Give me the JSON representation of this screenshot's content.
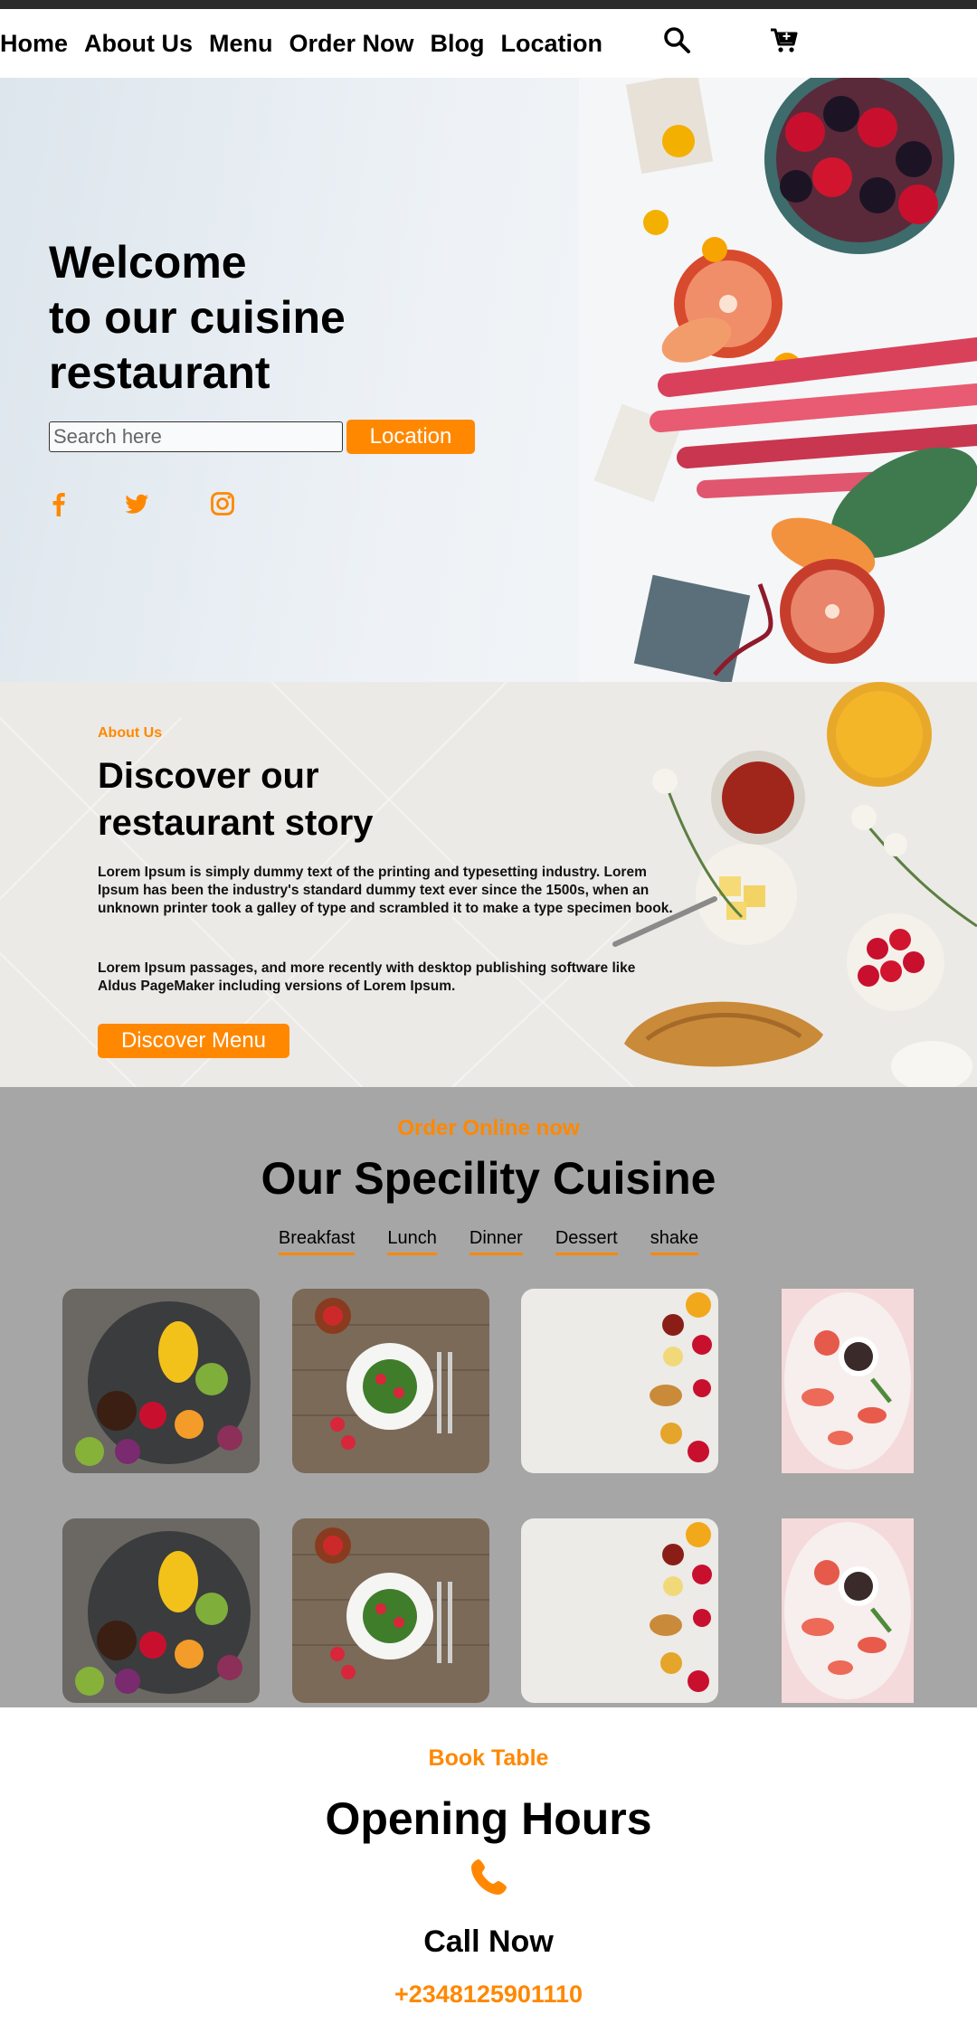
{
  "nav": {
    "links": [
      "Home",
      "About Us",
      "Menu",
      "Order Now",
      "Blog",
      "Location"
    ],
    "icons": [
      "search-icon",
      "cart-icon"
    ]
  },
  "hero": {
    "title_lines": [
      "Welcome",
      "to our cuisine",
      "restaurant"
    ],
    "search_placeholder": "Search here",
    "location_button": "Location",
    "social_icons": [
      "facebook-icon",
      "twitter-icon",
      "instagram-icon"
    ],
    "accent_color": "#ff8800"
  },
  "about": {
    "label": "About Us",
    "title_lines": [
      "Discover our",
      "restaurant story"
    ],
    "paragraph1": "Lorem Ipsum is simply dummy text of the printing and typesetting industry. Lorem Ipsum has been the industry's standard dummy text ever since the 1500s, when an unknown printer took a galley of type and scrambled it to make a type specimen book.",
    "paragraph2": "Lorem Ipsum passages, and more recently with desktop publishing software like Aldus PageMaker including versions of Lorem Ipsum.",
    "button": "Discover Menu"
  },
  "cuisine": {
    "label": "Order Online now",
    "title": "Our Specility Cuisine",
    "tabs": [
      "Breakfast",
      "Lunch",
      "Dinner",
      "Dessert",
      "shake"
    ],
    "background_color": "#a6a6a6"
  },
  "book": {
    "label": "Book Table",
    "title": "Opening Hours",
    "call_label": "Call Now",
    "phone": "+2348125901110"
  }
}
